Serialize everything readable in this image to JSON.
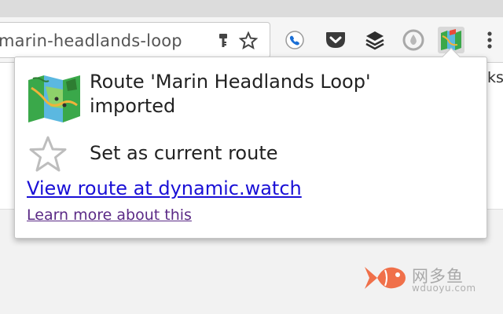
{
  "browser": {
    "url": "marin-headlands-loop",
    "page_cut_text": "ks"
  },
  "toolbar": {
    "icons": [
      "key-icon",
      "bookmark-star-icon",
      "phone-extension-icon",
      "pocket-icon",
      "layers-icon",
      "drop-icon",
      "map-extension-icon",
      "menu-icon"
    ]
  },
  "popup": {
    "title": "Route 'Marin Headlands Loop' imported",
    "set_current_label": "Set as current route",
    "view_link": "View route at dynamic.watch",
    "learn_link": "Learn more about this"
  },
  "watermark": {
    "cn": "网多鱼",
    "en": "wduoyu.com"
  },
  "colors": {
    "link": "#1a10d6",
    "visited_link": "#5b2a86",
    "map_green": "#3aa84a",
    "map_blue": "#5bb8e0",
    "watermark_fish": "#f0704a"
  }
}
